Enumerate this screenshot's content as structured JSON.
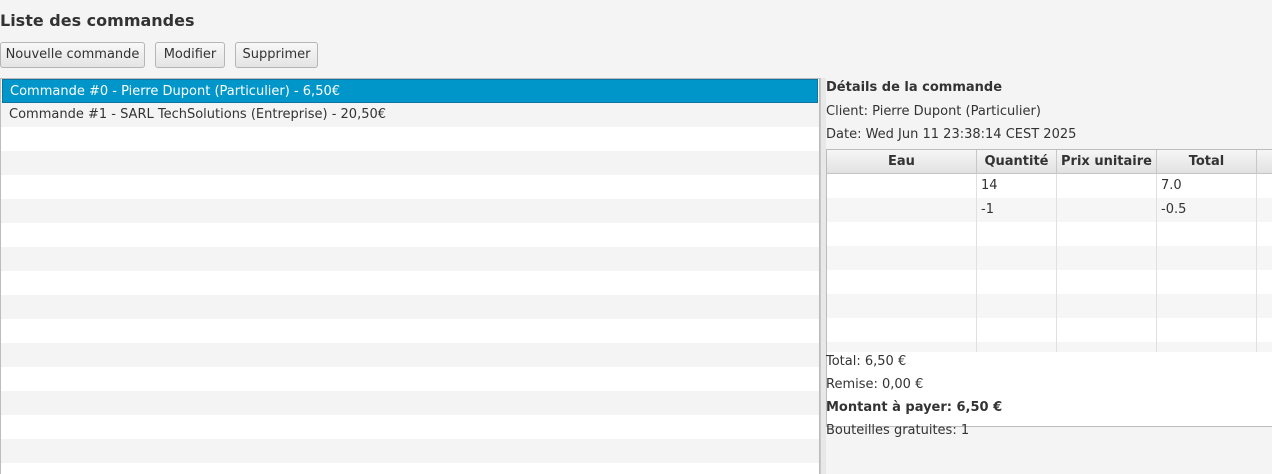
{
  "title": "Liste des commandes",
  "toolbar": {
    "new_label": "Nouvelle commande",
    "edit_label": "Modifier",
    "delete_label": "Supprimer"
  },
  "orders": [
    {
      "label": "Commande #0 - Pierre Dupont (Particulier) - 6,50€",
      "selected": true
    },
    {
      "label": "Commande #1 - SARL TechSolutions (Entreprise) - 20,50€",
      "selected": false
    }
  ],
  "details": {
    "heading": "Détails de la commande",
    "client": "Client: Pierre Dupont (Particulier)",
    "date": "Date: Wed Jun 11 23:38:14 CEST 2025",
    "table": {
      "headers": [
        "Eau",
        "Quantité",
        "Prix unitaire",
        "Total"
      ],
      "rows": [
        [
          "",
          "14",
          "",
          "7.0"
        ],
        [
          "",
          "-1",
          "",
          "-0.5"
        ]
      ]
    },
    "total": "Total: 6,50 €",
    "discount": "Remise: 0,00 €",
    "amount_due": "Montant à payer: 6,50 €",
    "free_bottles": "Bouteilles gratuites: 1"
  },
  "colors": {
    "selection": "#0096c9",
    "background": "#f4f4f4"
  }
}
